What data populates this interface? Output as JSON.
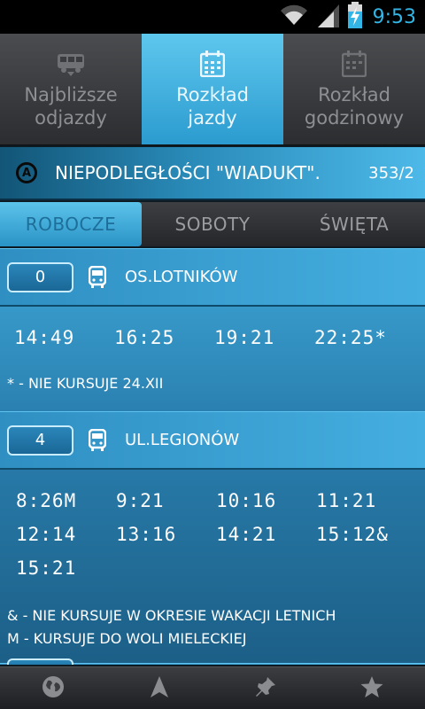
{
  "status": {
    "time": "9:53"
  },
  "top_tabs": [
    {
      "label": "Najbliższe\nodjazdy",
      "icon": "bus-icon",
      "active": false
    },
    {
      "label": "Rozkład\njazdy",
      "icon": "calendar-icon",
      "active": true
    },
    {
      "label": "Rozkład\ngodzinowy",
      "icon": "calendar-icon",
      "active": false
    }
  ],
  "stop": {
    "icon": "circle-a-icon",
    "name": "NIEPODLEGŁOŚCI \"WIADUKT\".",
    "code": "353/2"
  },
  "day_tabs": [
    {
      "label": "ROBOCZE",
      "active": true
    },
    {
      "label": "SOBOTY",
      "active": false
    },
    {
      "label": "ŚWIĘTA",
      "active": false
    }
  ],
  "lines": [
    {
      "number": "0",
      "direction": "OS.LOTNIKÓW",
      "times": [
        [
          "14:49",
          "16:25",
          "19:21",
          "22:25*"
        ]
      ],
      "notes": [
        "* - NIE KURSUJE 24.XII"
      ]
    },
    {
      "number": "4",
      "direction": "UL.LEGIONÓW",
      "times": [
        [
          " 8:26M",
          " 9:21",
          "10:16",
          "11:21"
        ],
        [
          "12:14",
          "13:16",
          "14:21",
          "15:12&"
        ],
        [
          "15:21"
        ]
      ],
      "notes": [
        "& - NIE KURSUJE W OKRESIE WAKACJI LETNICH",
        "M - KURSUJE DO WOLI MIELECKIEJ"
      ]
    }
  ],
  "bottom_nav": [
    {
      "icon": "globe-icon"
    },
    {
      "icon": "navigation-arrow-icon"
    },
    {
      "icon": "pin-icon"
    },
    {
      "icon": "star-icon"
    }
  ],
  "colors": {
    "accent": "#33b5e5",
    "active_tab": "#3fb3e3",
    "content_bg": "#2a80b0"
  }
}
